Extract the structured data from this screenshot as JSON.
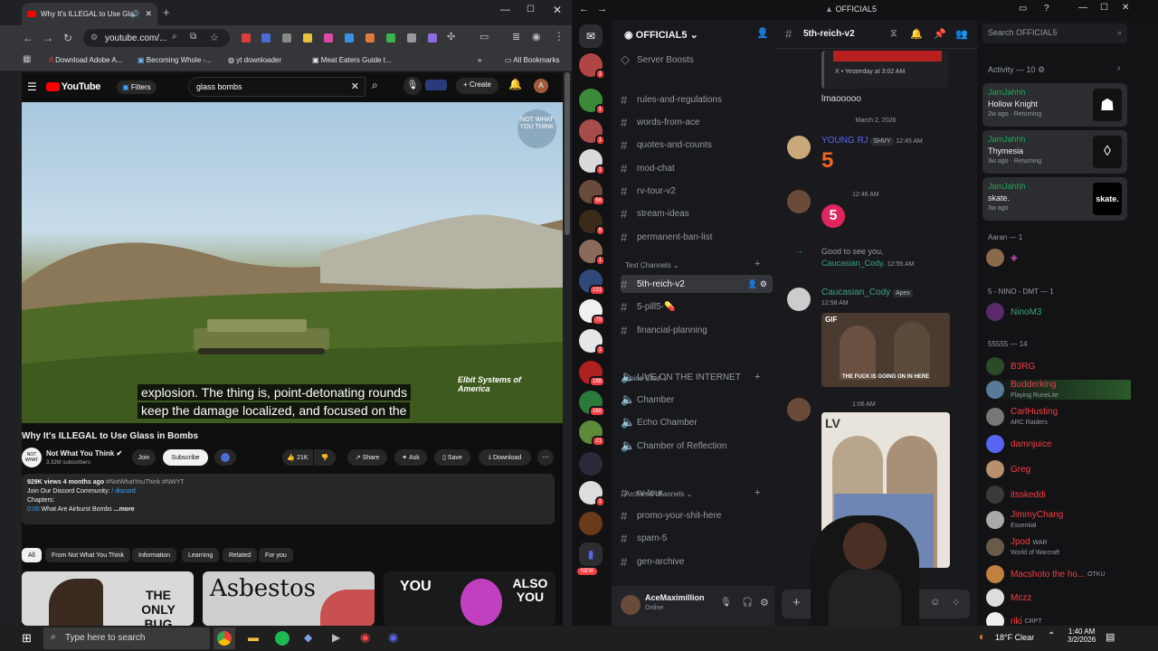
{
  "chrome": {
    "tab_title": "Why It's ILLEGAL to Use Gla",
    "url": "youtube.com/...",
    "bookmarks": [
      "Download Adobe A...",
      "Becoming Whole -...",
      "yt downloader",
      "Meat Eaters Guide t...",
      "All Bookmarks"
    ]
  },
  "youtube": {
    "logo": "YouTube",
    "filters": "Filters",
    "search_value": "glass bombs",
    "create": "Create",
    "avatar": "A",
    "caption_line1": "explosion. The thing is, point-detonating rounds",
    "caption_line2": "keep the damage localized, and focused on the",
    "watermark": "NOT WHAT YOU THINK",
    "sponsor_logo": "Elbit Systems of America",
    "title": "Why It's ILLEGAL to Use Glass in Bombs",
    "channel": "Not What You Think",
    "subscribers": "3.32M subscribers",
    "join": "Join",
    "subscribe": "Subscribe",
    "likes": "21K",
    "share": "Share",
    "ask": "Ask",
    "save": "Save",
    "download": "Download",
    "desc_meta": "929K views  4 months ago",
    "desc_tags": "#NotWhatYouThink #NWYT",
    "desc_line2": "Join Our Discord Community:",
    "desc_link": "/ discord",
    "desc_line3": "Chapters:",
    "desc_time": "0:00",
    "desc_chapter": "What Are Airburst Bombs",
    "desc_more": "...more",
    "chips": [
      "All",
      "From Not What You Think",
      "Information",
      "Learning",
      "Related",
      "For you"
    ],
    "thumb1": "THE ONLY BUG",
    "thumb2": "Asbestos",
    "thumb3_a": "YOU",
    "thumb3_b": "ALSO YOU"
  },
  "discord": {
    "window_title": "OFFICIAL5",
    "server_name": "OFFICIAL5",
    "channel_header": "5th-reich-v2",
    "search_placeholder": "Search OFFICIAL5",
    "server_boosts": "Server Boosts",
    "channels_top": [
      "rules-and-regulations",
      "words-from-ace",
      "quotes-and-counts",
      "mod-chat",
      "rv-tour-v2",
      "stream-ideas",
      "permanent-ban-list"
    ],
    "cat_text": "Text Channels",
    "text_channels": [
      "5th-reich-v2",
      "5-pill5-💊",
      "financial-planning"
    ],
    "cat_voice": "Voice Chat",
    "voice_channels": [
      "LIVE ON THE INTERNET",
      "Chamber",
      "Echo Chamber",
      "Chamber of Reflection"
    ],
    "cat_archived": "Archived channels",
    "archived_channels": [
      "rv-tour",
      "promo-your-shit-here",
      "spam-5",
      "gen-archive"
    ],
    "new_badge": "NEW",
    "user_name": "AceMaximillion",
    "user_status": "Online",
    "guild_badges": [
      "1",
      "1",
      "1",
      "1",
      "1",
      "66",
      "6",
      "1",
      "131",
      "79",
      "1",
      "188",
      "160",
      "21",
      "1"
    ],
    "chat": {
      "reply_meta": "X • Yesterday at 3:02 AM",
      "msg1": "lmaooooo",
      "date_divider": "March 2, 2026",
      "young_rj": "YOUNG RJ",
      "young_rj_tag": "SHVY",
      "young_rj_time": "12:45 AM",
      "time2": "12:46 AM",
      "join_text": "Good to see you,",
      "join_user": "Caucasian_Cody.",
      "join_time": "12:55 AM",
      "cody": "Caucasian_Cody",
      "cody_tag": "Apex",
      "cody_time": "12:58 AM",
      "gif_label": "GIF",
      "gif_caption": "THE FUCK IS GOING ON IN HERE",
      "time3": "1:06 AM"
    },
    "members": {
      "activity_header": "Activity — 10",
      "activities": [
        {
          "user": "JamJahhh",
          "game": "Hollow Knight",
          "meta": "2w ago  ·  Returning"
        },
        {
          "user": "JamJahhh",
          "game": "Thymesia",
          "meta": "3w ago  ·  Returning"
        },
        {
          "user": "JamJahhh",
          "game": "skate.",
          "meta": "3w ago"
        }
      ],
      "group1": "Aaran — 1",
      "group2": "5 - NINO - DMT — 1",
      "nino": "NinoM3",
      "group3": "55555 — 14",
      "list": [
        {
          "name": "B3RG",
          "sub": "",
          "color": "#f23f43"
        },
        {
          "name": "Budderking",
          "sub": "Playing RuneLite",
          "color": "#f23f43"
        },
        {
          "name": "CarlHusting",
          "sub": "ARC Raiders",
          "color": "#f23f43"
        },
        {
          "name": "damnjuice",
          "sub": "",
          "color": "#f23f43"
        },
        {
          "name": "Greg",
          "sub": "",
          "color": "#f23f43"
        },
        {
          "name": "itsskeddi",
          "sub": "",
          "color": "#f23f43"
        },
        {
          "name": "JimmyChang",
          "sub": "Essential",
          "color": "#f23f43"
        },
        {
          "name": "Jpod",
          "sub": "World of Warcraft",
          "color": "#f23f43"
        },
        {
          "name": "Macshoto the ho...",
          "sub": "",
          "color": "#f23f43"
        },
        {
          "name": "Mczz",
          "sub": "",
          "color": "#f23f43"
        },
        {
          "name": "riki",
          "sub": "",
          "color": "#f23f43"
        }
      ],
      "jpod_tag": "WAR",
      "mac_tag": "OTKU",
      "riki_tag": "CRPT"
    }
  },
  "taskbar": {
    "search_placeholder": "Type here to search",
    "weather": "18°F  Clear",
    "time": "1:40 AM",
    "date": "3/2/2026"
  }
}
